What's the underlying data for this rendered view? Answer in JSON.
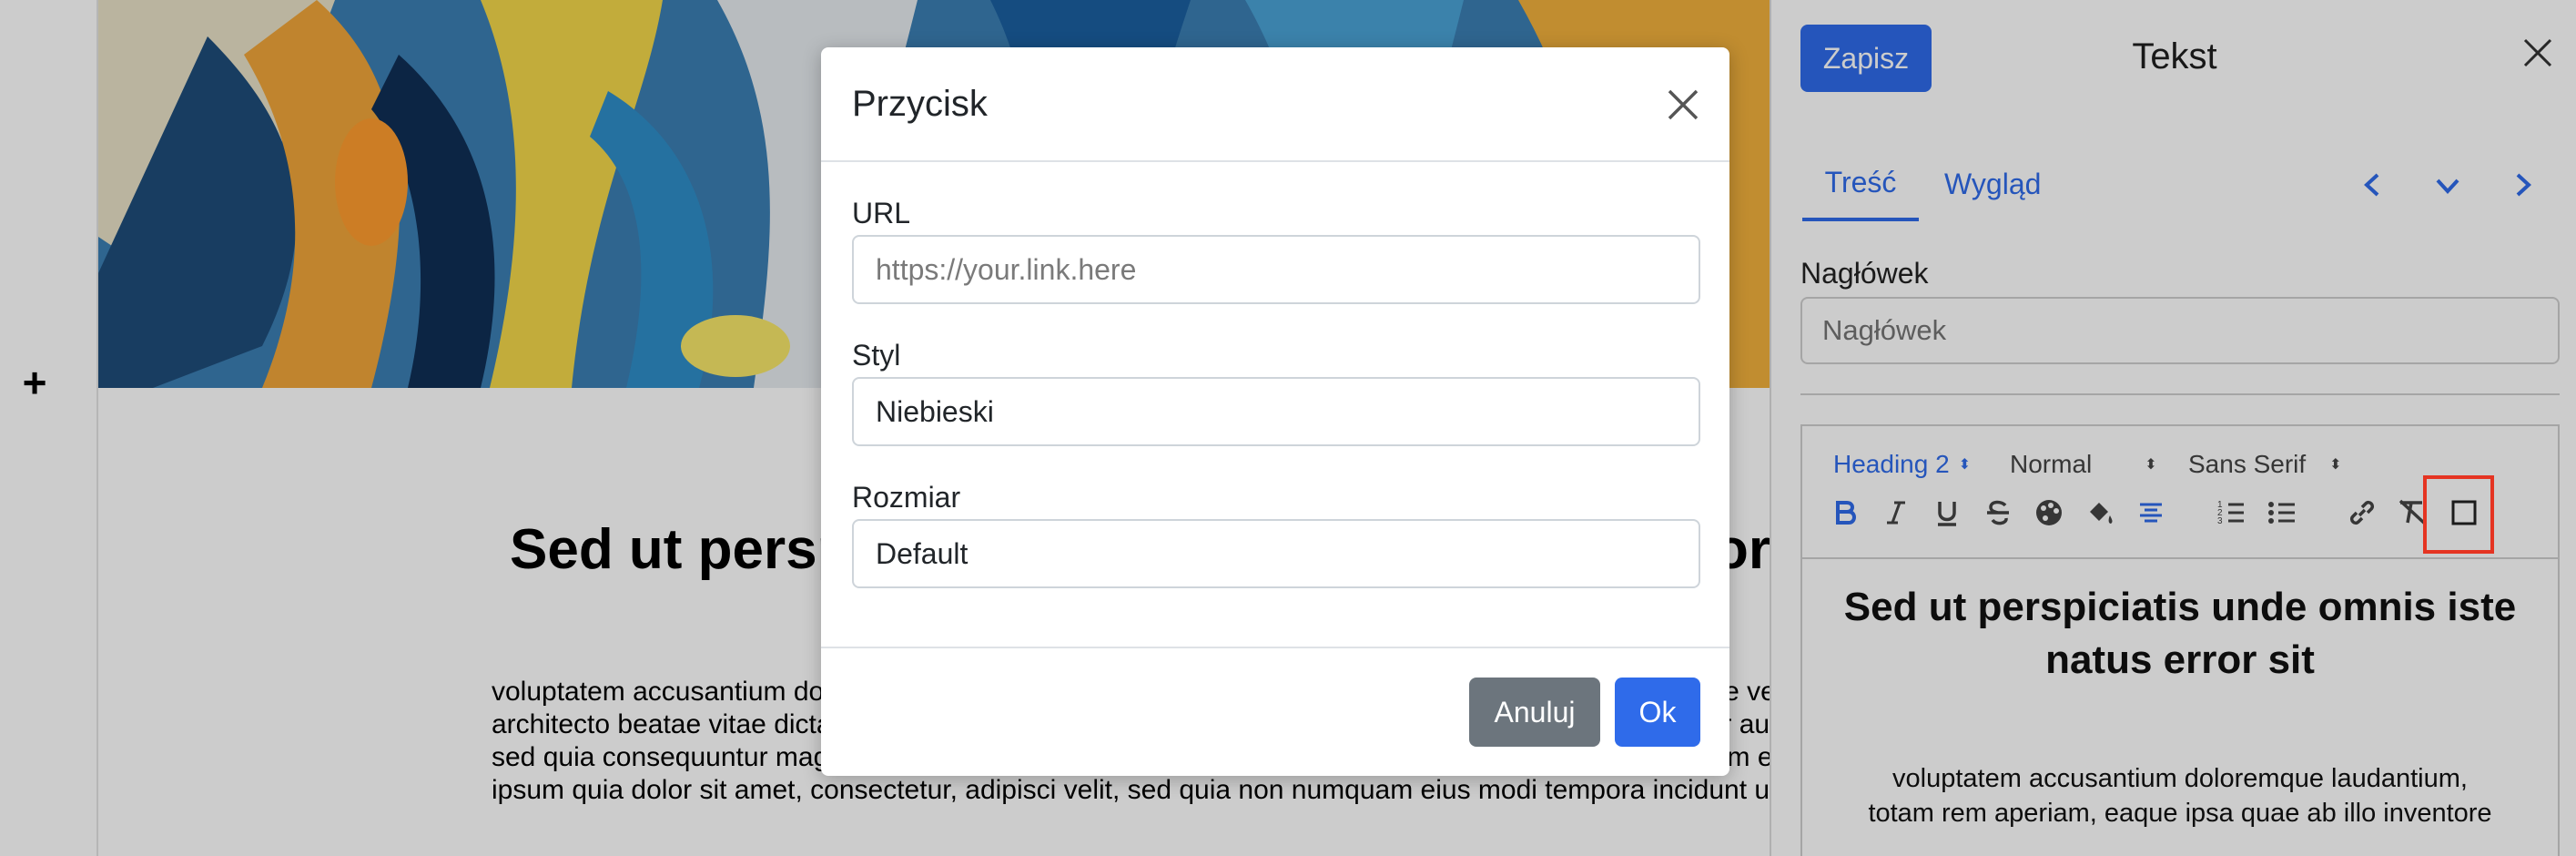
{
  "canvas": {
    "add_block_label": "+",
    "heading": "Sed ut perspiciatis unde omnis iste natus error sit",
    "body_lines": [
      "voluptatem accusantium doloremque laudantium, totam rem aperiam, eaque ipsa quae ab illo inventore veritatis et quasi",
      "architecto beatae vitae dicta sunt explicabo. Nemo enim ipsam voluptatem quia voluptas sit aspernatur aut odit aut fugit,",
      "sed quia consequuntur magni dolores eos qui ratione voluptatem sequi nesciunt. Neque porro quisquam est, qui dolorem",
      "ipsum quia dolor sit amet, consectetur, adipisci velit, sed quia non numquam eius modi tempora incidunt ut labore"
    ]
  },
  "panel": {
    "save_label": "Zapisz",
    "title": "Tekst",
    "tabs": [
      {
        "label": "Treść"
      },
      {
        "label": "Wygląd"
      }
    ],
    "heading_field": {
      "label": "Nagłówek",
      "placeholder": "Nagłówek"
    },
    "toolbar": {
      "block_format": "Heading 2",
      "size": "Normal",
      "font": "Sans Serif",
      "buttons": [
        "bold-icon",
        "italic-icon",
        "underline-icon",
        "strikethrough-icon",
        "text-color-icon",
        "background-color-icon",
        "align-center-icon",
        "ordered-list-icon",
        "bullet-list-icon",
        "link-icon",
        "clear-format-icon",
        "button-insert-icon"
      ]
    },
    "editor": {
      "heading": "Sed ut perspiciatis unde omnis iste natus error sit",
      "para_line1": "voluptatem accusantium doloremque laudantium,",
      "para_line2": "totam rem aperiam, eaque ipsa quae ab illo inventore"
    }
  },
  "modal": {
    "title": "Przycisk",
    "url_label": "URL",
    "url_placeholder": "https://your.link.here",
    "style_label": "Styl",
    "style_value": "Niebieski",
    "size_label": "Rozmiar",
    "size_value": "Default",
    "cancel_label": "Anuluj",
    "ok_label": "Ok"
  },
  "colors": {
    "accent": "#2f6bea",
    "cancel": "#6c757d",
    "highlight": "#e53422"
  }
}
